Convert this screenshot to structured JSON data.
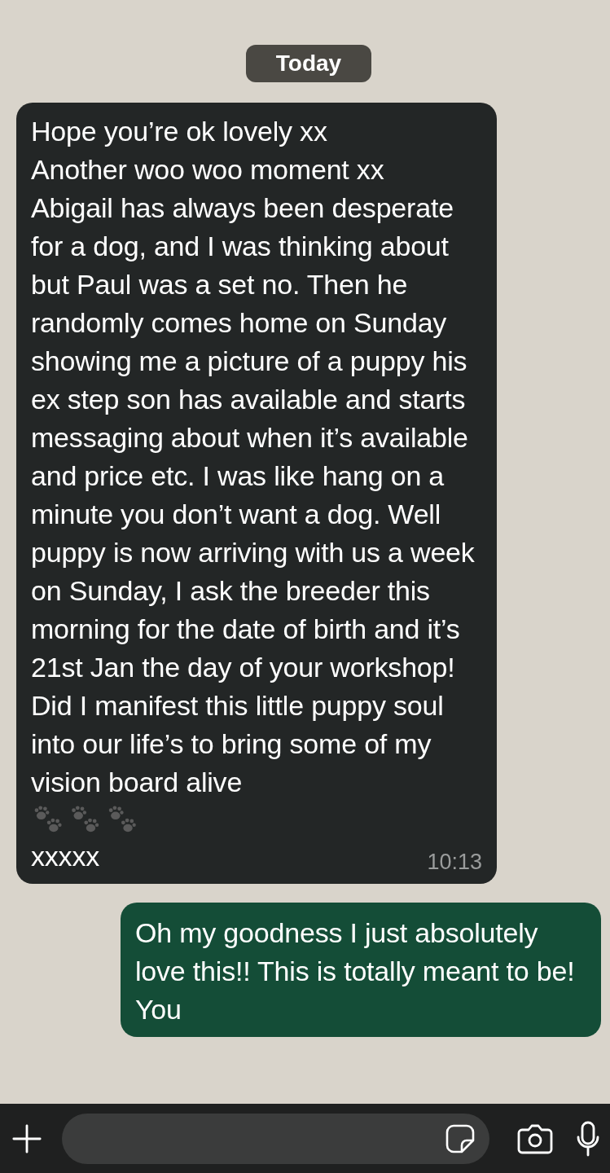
{
  "date_chip": "Today",
  "messages": [
    {
      "kind": "incoming",
      "text": "Hope you’re ok lovely xx\nAnother woo woo moment xx\nAbigail has always been desperate for a dog, and I was thinking about but Paul was a set no. Then he randomly comes home on Sunday showing me a picture of a puppy his ex step son has available and starts messaging about when it’s available and price etc. I was like hang on a minute you don’t want a dog. Well puppy is now arriving with us a week on Sunday, I ask the breeder this morning for the date of birth and it’s 21st Jan the day of your workshop! Did I manifest this little puppy soul into our life’s to bring some of my vision board alive",
      "signoff": "xxxxx",
      "time": "10:13"
    },
    {
      "kind": "outgoing",
      "text": "Oh my goodness I just absolutely love this!! This is totally meant to be! You"
    }
  ]
}
